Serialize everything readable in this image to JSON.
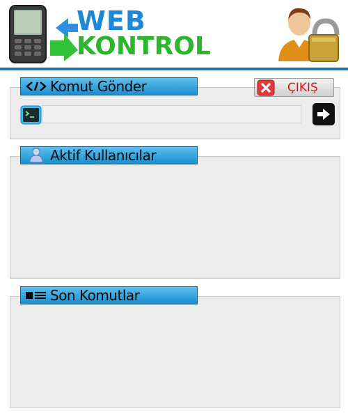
{
  "header": {
    "logo_web": "WEB",
    "logo_kontrol": "KONTROL",
    "logo_icon": "mobile-phone-icon",
    "user_icon": "user-lock-icon"
  },
  "command_panel": {
    "title": "Komut Gönder",
    "title_icon": "code-icon",
    "exit_label": "ÇIKIŞ",
    "exit_icon": "close-icon",
    "input_value": "",
    "input_icon": "terminal-icon",
    "send_icon": "arrow-right-icon"
  },
  "users_panel": {
    "title": "Aktif Kullanıcılar",
    "title_icon": "user-icon",
    "items": []
  },
  "recent_panel": {
    "title": "Son Komutlar",
    "title_icon": "list-icon",
    "items": []
  },
  "colors": {
    "title_bar": "#1a8ed0",
    "header_line": "#1e73a8",
    "logo_web": "#1e88d8",
    "logo_kontrol": "#2db52d",
    "exit_text": "#d21c1c",
    "panel_bg": "#ececec"
  }
}
